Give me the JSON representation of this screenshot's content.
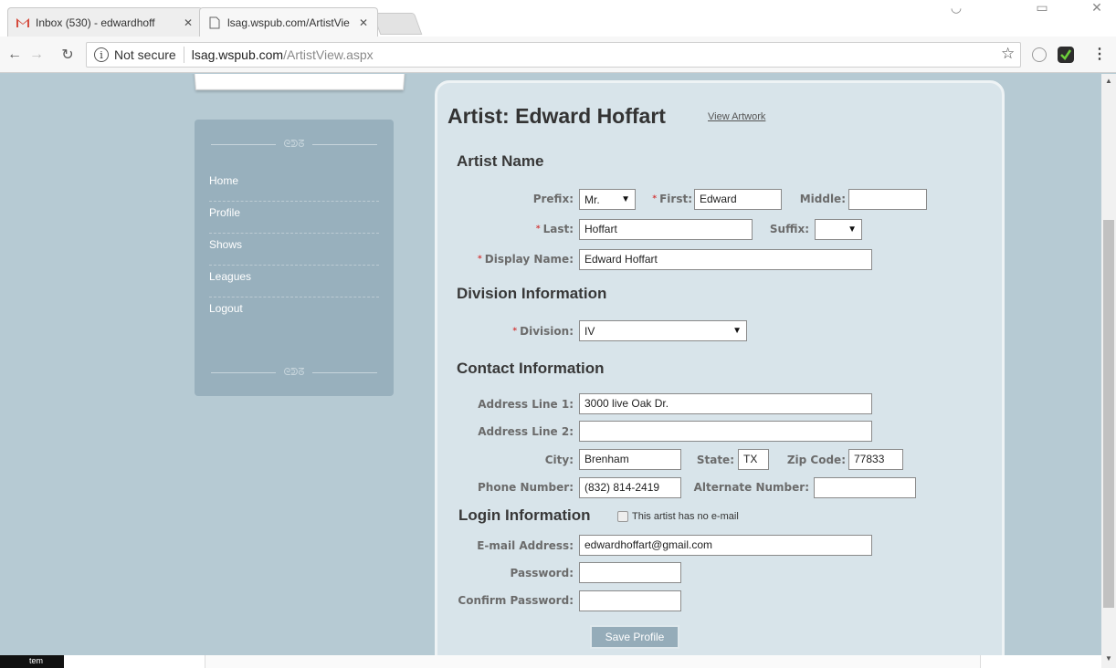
{
  "browser": {
    "tabs": [
      {
        "title": "Inbox (530) - edwardhoff",
        "active": false,
        "icon": "gmail-icon"
      },
      {
        "title": "lsag.wspub.com/ArtistVie",
        "active": true,
        "icon": "page-icon"
      }
    ],
    "security_label": "Not secure",
    "url_host": "lsag.wspub.com",
    "url_path": "/ArtistView.aspx"
  },
  "sidebar": {
    "items": [
      {
        "label": "Home"
      },
      {
        "label": "Profile"
      },
      {
        "label": "Shows"
      },
      {
        "label": "Leagues"
      },
      {
        "label": "Logout"
      }
    ]
  },
  "main": {
    "title": "Artist: Edward Hoffart",
    "view_artwork_link": "View Artwork",
    "sections": {
      "artist_name": "Artist Name",
      "division": "Division Information",
      "contact": "Contact Information",
      "login": "Login Information"
    },
    "artist_name": {
      "prefix_label": "Prefix:",
      "prefix_value": "Mr.",
      "first_label": "First:",
      "first_value": "Edward",
      "middle_label": "Middle:",
      "middle_value": "",
      "last_label": "Last:",
      "last_value": "Hoffart",
      "suffix_label": "Suffix:",
      "suffix_value": "",
      "display_label": "Display Name:",
      "display_value": "Edward Hoffart"
    },
    "division": {
      "label": "Division:",
      "value": "IV"
    },
    "contact": {
      "address1_label": "Address Line 1:",
      "address1_value": "3000 live Oak Dr.",
      "address2_label": "Address Line 2:",
      "address2_value": "",
      "city_label": "City:",
      "city_value": "Brenham",
      "state_label": "State:",
      "state_value": "TX",
      "zip_label": "Zip Code:",
      "zip_value": "77833",
      "phone_label": "Phone Number:",
      "phone_value": "(832) 814-2419",
      "alt_label": "Alternate Number:",
      "alt_value": ""
    },
    "login": {
      "no_email_label": "This artist has no e-mail",
      "email_label": "E-mail Address:",
      "email_value": "edwardhoffart@gmail.com",
      "password_label": "Password:",
      "password_value": "",
      "confirm_label": "Confirm Password:",
      "confirm_value": ""
    },
    "save_button": "Save Profile"
  },
  "taskbar": {
    "fragment": "tem"
  },
  "colors": {
    "page_bg": "#b6cad3",
    "sidebar_bg": "#98b0bd",
    "panel_bg": "#d8e4ea",
    "required": "#d23a3a",
    "button_bg": "#95acb9"
  }
}
